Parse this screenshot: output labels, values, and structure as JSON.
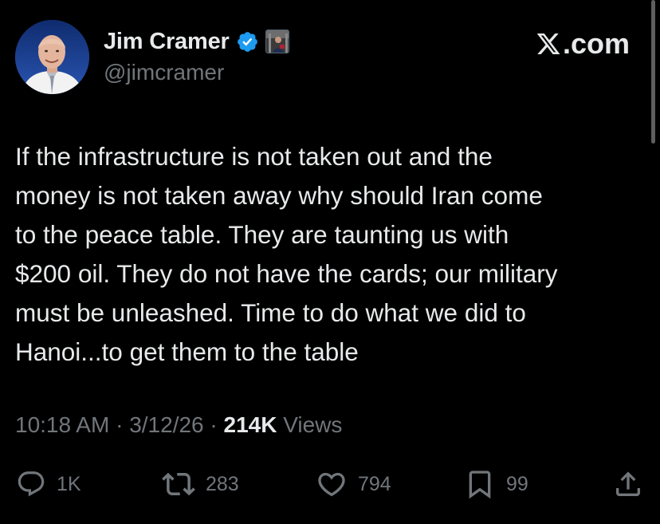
{
  "author": {
    "display_name": "Jim Cramer",
    "handle": "@jimcramer",
    "avatar_icon": "profile-photo",
    "verified_icon": "verified-badge-icon",
    "affiliation_icon": "affiliation-badge-icon"
  },
  "brand": {
    "label": ".com",
    "icon": "x-logo-icon"
  },
  "tweet": {
    "lines": [
      "If the infrastructure is not taken out and the",
      "money is not taken away why should Iran come",
      "to the peace table. They are taunting us with",
      "$200 oil. They do not have the cards; our military",
      "must be unleashed. Time to do what we did to",
      "Hanoi...to get them to the table"
    ]
  },
  "meta": {
    "time": "10:18 AM",
    "separator": " · ",
    "date": "3/12/26",
    "views_count": "214K",
    "views_label": " Views"
  },
  "actions": {
    "replies": "1K",
    "reposts": "283",
    "likes": "794",
    "bookmarks": "99"
  },
  "colors": {
    "background": "#000000",
    "text": "#e7e9ea",
    "muted": "#71767b",
    "verified": "#1d9bf0"
  }
}
